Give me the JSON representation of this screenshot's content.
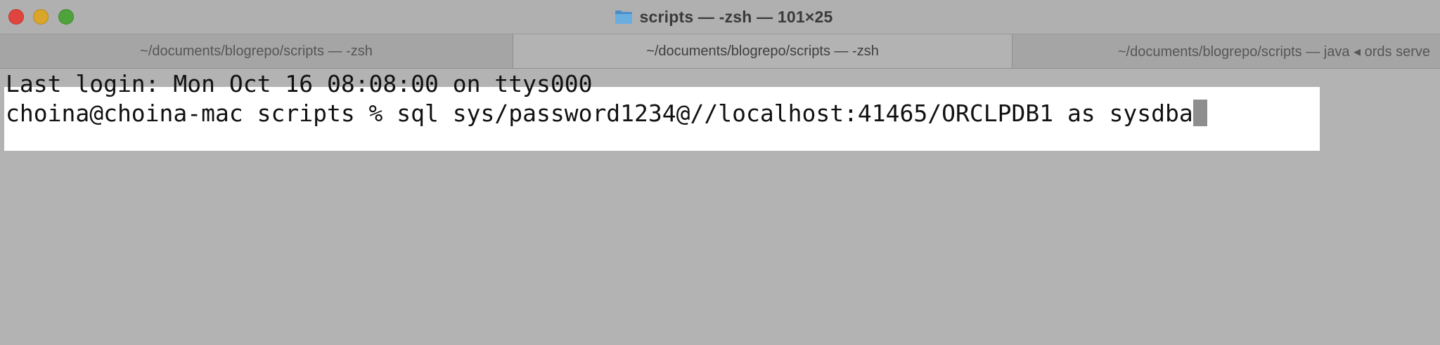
{
  "window": {
    "title": "scripts — -zsh — 101×25",
    "folder_icon": "folder-icon"
  },
  "traffic_lights": {
    "close_color": "#e0443e",
    "minimize_color": "#d9a62a",
    "maximize_color": "#4ea33a"
  },
  "tabs": [
    {
      "label": "~/documents/blogrepo/scripts — -zsh",
      "active": false
    },
    {
      "label": "~/documents/blogrepo/scripts — -zsh",
      "active": true
    },
    {
      "label": "~/documents/blogrepo/scripts — java ◂ ords serve",
      "active": false
    }
  ],
  "terminal": {
    "last_login": "Last login: Mon Oct 16 08:08:00 on ttys000",
    "prompt_command": "choina@choina-mac scripts % sql sys/password1234@//localhost:41465/ORCLPDB1 as sysdba"
  }
}
